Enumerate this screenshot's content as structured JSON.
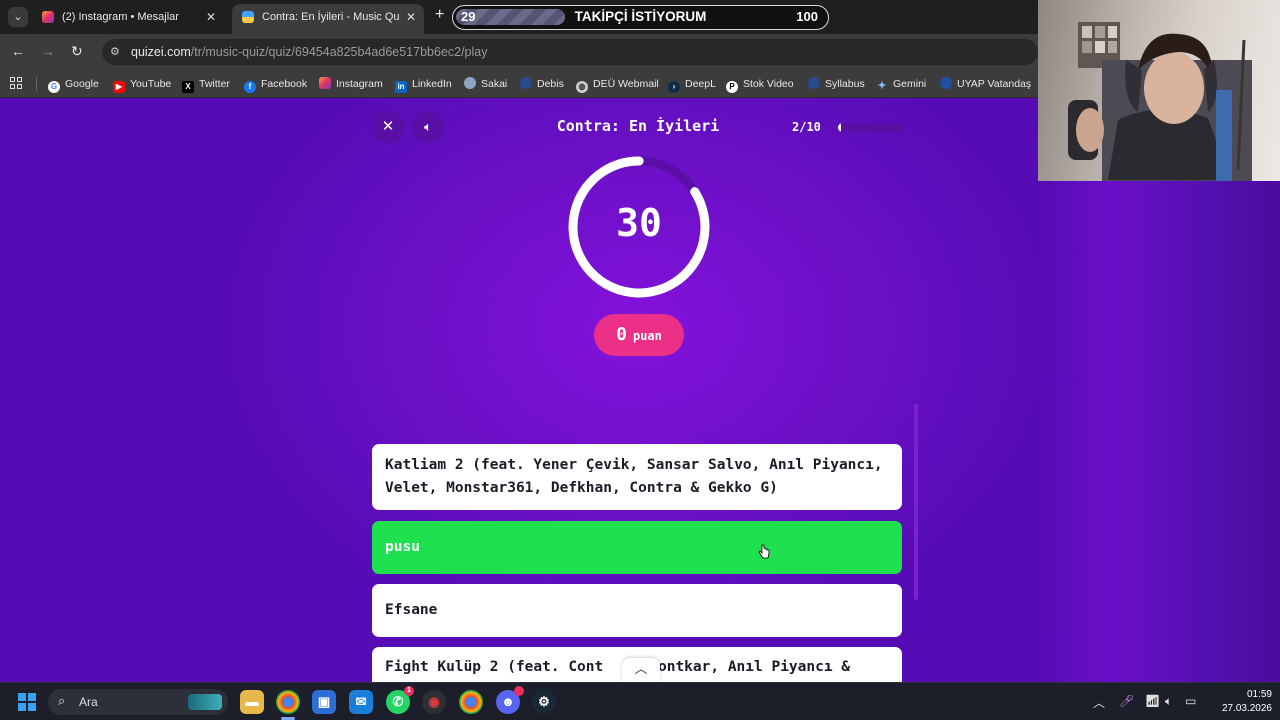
{
  "browser": {
    "tabs": [
      {
        "title": "(2) Instagram • Mesajlar",
        "active": false
      },
      {
        "title": "Contra: En İyileri - Music Quiz",
        "active": true
      }
    ],
    "url_host": "quizei.com",
    "url_path": "/tr/music-quiz/quiz/69454a825b4ad6e517bb6ec2/play",
    "bookmarks": [
      "Google",
      "YouTube",
      "Twitter",
      "Facebook",
      "Instagram",
      "LinkedIn",
      "Sakai",
      "Debis",
      "DEÜ Webmail",
      "DeepL",
      "Stok Video",
      "Syllabus",
      "Gemini",
      "UYAP Vatandaş"
    ]
  },
  "follower_overlay": {
    "current": "29",
    "label": "TAKİPÇİ İSTİYORUM",
    "goal": "100",
    "fill_fraction": 0.29
  },
  "quiz": {
    "title": "Contra: En İyileri",
    "progress_text": "2/10",
    "progress_fraction": 0.05,
    "timer": "30",
    "timer_fraction": 0.84,
    "score_value": "0",
    "score_unit": "puan",
    "answers": [
      {
        "text": "Katliam 2 (feat. Yener Çevik, Sansar Salvo, Anıl Piyancı, Velet, Monstar361, Defkhan, Contra & Gekko G)",
        "state": "normal"
      },
      {
        "text": "pusu",
        "state": "correct"
      },
      {
        "text": "Efsane",
        "state": "normal"
      },
      {
        "text": "Fight Kulüp 2 (feat. Cont",
        "state": "normal"
      },
      {
        "text": "hontkar, Anıl Piyancı &",
        "state": "normal"
      }
    ]
  },
  "taskbar": {
    "search_placeholder": "Ara",
    "time": "01:59",
    "date": "27.03.2026"
  },
  "colors": {
    "page_bg": "#6a10c6",
    "correct": "#1fe04f",
    "score_pill": "#ec2f87",
    "tab_active": "#3c3c3c"
  }
}
